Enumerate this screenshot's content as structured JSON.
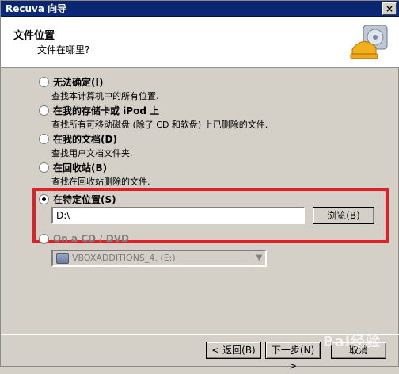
{
  "window": {
    "title": "Recuva 向导",
    "close_glyph": "×"
  },
  "header": {
    "title": "文件位置",
    "subtitle": "文件在哪里?"
  },
  "options": [
    {
      "label": "无法确定(I)",
      "desc": "查找本计算机中的所有位置.",
      "selected": false
    },
    {
      "label": "在我的存储卡或 iPod 上",
      "desc": "查找所有可移动磁盘 (除了 CD 和软盘) 上已删除的文件.",
      "selected": false
    },
    {
      "label": "在我的文档(D)",
      "desc": "查找用户文档文件夹.",
      "selected": false
    },
    {
      "label": "在回收站(B)",
      "desc": "查找在回收站删除的文件.",
      "selected": false
    },
    {
      "label": "在特定位置(S)",
      "desc": "",
      "selected": true
    },
    {
      "label": "On a CD / DVD",
      "desc": "",
      "selected": false,
      "disabled": true
    }
  ],
  "path": {
    "value": "D:\\",
    "browse_label": "浏览(B)"
  },
  "cd_dropdown": {
    "selected": "VBOXADDITIONS_4. (E:)"
  },
  "buttons": {
    "back": "< 返回(B)",
    "next": "下一步(N) >",
    "cancel": "取消"
  },
  "watermark": "Bai经验"
}
